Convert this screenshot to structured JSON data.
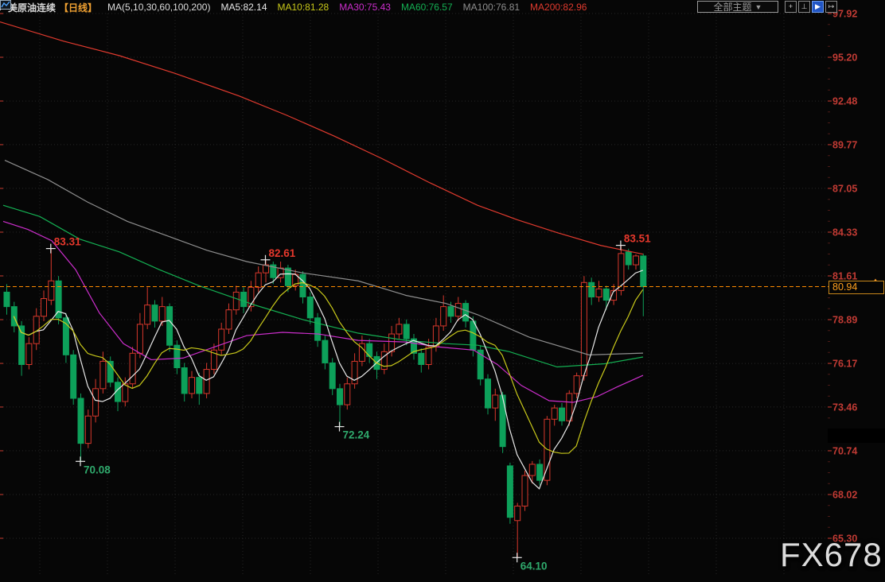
{
  "header": {
    "title": "美原油连续",
    "period": "【日线】",
    "ma_settings": "MA(5,10,30,60,100,200)",
    "ma_values": [
      {
        "label": "MA5:82.14",
        "color": "#e8e8e8"
      },
      {
        "label": "MA10:81.28",
        "color": "#c9c91a"
      },
      {
        "label": "MA30:75.43",
        "color": "#cc2ecc"
      },
      {
        "label": "MA60:76.57",
        "color": "#14b053"
      },
      {
        "label": "MA100:76.81",
        "color": "#8e8e8e"
      },
      {
        "label": "MA200:82.96",
        "color": "#e03a2e"
      }
    ],
    "theme_dropdown": "全部主题",
    "dropdown_arrow": "▼",
    "toolbar_icons": [
      {
        "name": "crosshair-icon",
        "glyph": "+",
        "active": false
      },
      {
        "name": "axis-scale-icon",
        "glyph": "⊥",
        "active": false
      },
      {
        "name": "axis-play-icon",
        "glyph": "▶",
        "active": true
      },
      {
        "name": "pan-right-icon",
        "glyph": "↦",
        "active": false
      }
    ]
  },
  "price_axis": {
    "labels": [
      "97.92",
      "95.20",
      "92.48",
      "89.77",
      "87.05",
      "84.33",
      "81.61",
      "78.89",
      "76.17",
      "73.46",
      "70.74",
      "68.02",
      "65.30"
    ],
    "label_color": "#c23b34",
    "current_price": "80.94",
    "current_price_value": 80.94,
    "line_color": "#ff8a00"
  },
  "watermark": "FX678",
  "chart_data": {
    "type": "candlestick",
    "title": "美原油连续 日线",
    "ylim": [
      65.3,
      97.92
    ],
    "grid": true,
    "legend_position": "top",
    "up_color": "#d8382c",
    "down_color": "#0da05a",
    "high_label_color": "#e6382c",
    "low_label_color": "#2fa96c",
    "last_price": 80.94,
    "candles": [
      [
        80.6,
        81.1,
        79.2,
        79.7
      ],
      [
        79.7,
        80.0,
        78.1,
        78.5
      ],
      [
        78.5,
        78.8,
        75.4,
        76.1
      ],
      [
        76.1,
        77.8,
        75.8,
        77.4
      ],
      [
        77.4,
        79.6,
        77.0,
        79.1
      ],
      [
        79.1,
        80.7,
        78.8,
        80.2
      ],
      [
        80.1,
        83.31,
        79.8,
        81.3
      ],
      [
        81.3,
        81.6,
        78.6,
        79.0
      ],
      [
        79.0,
        79.3,
        76.2,
        76.7
      ],
      [
        76.7,
        77.0,
        73.6,
        74.0
      ],
      [
        74.0,
        74.3,
        70.08,
        71.2
      ],
      [
        71.2,
        73.3,
        70.9,
        72.9
      ],
      [
        72.9,
        75.2,
        72.5,
        74.6
      ],
      [
        74.6,
        76.9,
        74.3,
        76.3
      ],
      [
        76.3,
        76.6,
        74.7,
        75.0
      ],
      [
        75.0,
        75.3,
        73.2,
        73.8
      ],
      [
        73.8,
        75.3,
        73.5,
        74.9
      ],
      [
        74.9,
        77.2,
        74.6,
        76.8
      ],
      [
        76.8,
        79.3,
        76.5,
        78.6
      ],
      [
        78.6,
        80.9,
        78.3,
        79.8
      ],
      [
        79.8,
        80.1,
        78.4,
        78.8
      ],
      [
        78.8,
        80.3,
        78.5,
        79.7
      ],
      [
        79.7,
        79.9,
        76.9,
        77.3
      ],
      [
        77.3,
        77.6,
        75.5,
        75.9
      ],
      [
        75.9,
        76.2,
        73.8,
        74.3
      ],
      [
        74.3,
        75.7,
        74.0,
        75.3
      ],
      [
        75.3,
        75.6,
        73.6,
        74.3
      ],
      [
        74.3,
        76.2,
        74.0,
        75.8
      ],
      [
        75.8,
        77.4,
        75.5,
        77.0
      ],
      [
        77.0,
        78.7,
        76.7,
        78.3
      ],
      [
        78.3,
        79.9,
        78.0,
        79.5
      ],
      [
        79.5,
        81.0,
        79.2,
        80.6
      ],
      [
        80.6,
        80.9,
        79.3,
        79.7
      ],
      [
        79.7,
        81.3,
        79.4,
        80.9
      ],
      [
        80.9,
        82.2,
        80.6,
        81.8
      ],
      [
        81.8,
        82.61,
        81.2,
        82.3
      ],
      [
        82.3,
        82.5,
        81.1,
        81.5
      ],
      [
        81.5,
        82.5,
        81.2,
        82.1
      ],
      [
        82.1,
        82.3,
        80.6,
        81.0
      ],
      [
        81.0,
        82.0,
        80.7,
        81.7
      ],
      [
        81.7,
        81.9,
        79.9,
        80.3
      ],
      [
        80.3,
        80.6,
        78.6,
        79.0
      ],
      [
        79.0,
        79.3,
        77.2,
        77.6
      ],
      [
        77.6,
        77.9,
        75.8,
        76.2
      ],
      [
        76.2,
        76.5,
        74.2,
        74.6
      ],
      [
        74.6,
        74.9,
        72.24,
        73.6
      ],
      [
        73.6,
        75.3,
        73.3,
        74.9
      ],
      [
        74.9,
        76.8,
        74.6,
        76.3
      ],
      [
        76.3,
        77.9,
        76.0,
        77.4
      ],
      [
        77.4,
        77.7,
        76.2,
        76.6
      ],
      [
        76.6,
        76.9,
        75.2,
        75.8
      ],
      [
        75.8,
        77.4,
        75.5,
        76.9
      ],
      [
        76.9,
        78.5,
        76.6,
        78.0
      ],
      [
        78.0,
        79.0,
        77.7,
        78.6
      ],
      [
        78.6,
        78.9,
        77.3,
        77.7
      ],
      [
        77.7,
        78.0,
        76.4,
        76.8
      ],
      [
        76.8,
        77.1,
        75.6,
        76.1
      ],
      [
        76.1,
        77.7,
        75.8,
        77.2
      ],
      [
        77.2,
        79.0,
        76.9,
        78.5
      ],
      [
        78.5,
        80.4,
        78.2,
        79.7
      ],
      [
        79.7,
        80.0,
        78.7,
        79.1
      ],
      [
        79.1,
        80.3,
        78.8,
        79.9
      ],
      [
        79.9,
        80.1,
        78.4,
        78.8
      ],
      [
        78.8,
        79.1,
        76.6,
        77.0
      ],
      [
        77.0,
        77.3,
        74.8,
        75.2
      ],
      [
        75.2,
        75.5,
        73.0,
        73.4
      ],
      [
        73.4,
        74.6,
        72.6,
        74.2
      ],
      [
        74.2,
        74.4,
        70.6,
        71.0
      ],
      [
        69.8,
        70.0,
        66.2,
        66.6
      ],
      [
        66.4,
        67.5,
        64.1,
        67.3
      ],
      [
        67.3,
        69.5,
        67.0,
        69.2
      ],
      [
        69.2,
        70.1,
        68.7,
        69.9
      ],
      [
        69.9,
        70.2,
        68.6,
        68.9
      ],
      [
        68.9,
        72.9,
        68.6,
        72.7
      ],
      [
        72.7,
        73.6,
        72.3,
        73.4
      ],
      [
        73.4,
        73.7,
        72.3,
        72.6
      ],
      [
        72.6,
        74.5,
        72.3,
        74.3
      ],
      [
        74.3,
        75.6,
        74.0,
        75.4
      ],
      [
        75.4,
        81.6,
        75.1,
        81.2
      ],
      [
        81.2,
        81.5,
        79.8,
        80.3
      ],
      [
        80.3,
        81.3,
        80.0,
        80.8
      ],
      [
        80.8,
        81.0,
        79.5,
        80.1
      ],
      [
        80.1,
        81.1,
        79.8,
        80.7
      ],
      [
        80.7,
        83.51,
        80.4,
        83.0
      ],
      [
        83.1,
        83.3,
        82.0,
        82.3
      ],
      [
        82.3,
        82.95,
        82.0,
        82.85
      ],
      [
        82.85,
        83.0,
        79.1,
        80.94
      ]
    ],
    "computed_ma": [
      {
        "name": "MA5",
        "window": 5,
        "color": "#e8e8e8"
      },
      {
        "name": "MA10",
        "window": 10,
        "color": "#c9c91a"
      }
    ],
    "ma_series": [
      {
        "name": "MA200",
        "color": "#e03a2e",
        "points": [
          [
            0,
            97.4
          ],
          [
            80,
            96.2
          ],
          [
            150,
            95.3
          ],
          [
            220,
            94.2
          ],
          [
            300,
            92.8
          ],
          [
            360,
            91.6
          ],
          [
            420,
            90.3
          ],
          [
            480,
            88.9
          ],
          [
            540,
            87.4
          ],
          [
            600,
            86.0
          ],
          [
            650,
            85.1
          ],
          [
            700,
            84.3
          ],
          [
            755,
            83.5
          ],
          [
            808,
            82.96
          ]
        ]
      },
      {
        "name": "MA100",
        "color": "#8e8e8e",
        "points": [
          [
            6,
            88.8
          ],
          [
            60,
            87.6
          ],
          [
            110,
            86.2
          ],
          [
            160,
            85.0
          ],
          [
            210,
            84.1
          ],
          [
            260,
            83.2
          ],
          [
            310,
            82.5
          ],
          [
            380,
            81.8
          ],
          [
            450,
            81.3
          ],
          [
            510,
            80.4
          ],
          [
            560,
            79.9
          ],
          [
            600,
            79.2
          ],
          [
            665,
            77.8
          ],
          [
            740,
            76.7
          ],
          [
            808,
            76.81
          ]
        ]
      },
      {
        "name": "MA60",
        "color": "#14b053",
        "points": [
          [
            4,
            86.0
          ],
          [
            50,
            85.3
          ],
          [
            100,
            83.9
          ],
          [
            150,
            83.1
          ],
          [
            200,
            82.0
          ],
          [
            250,
            81.0
          ],
          [
            320,
            79.8
          ],
          [
            380,
            78.9
          ],
          [
            450,
            78.05
          ],
          [
            510,
            77.6
          ],
          [
            560,
            77.4
          ],
          [
            600,
            77.3
          ],
          [
            640,
            76.9
          ],
          [
            700,
            75.95
          ],
          [
            760,
            76.15
          ],
          [
            808,
            76.57
          ]
        ]
      },
      {
        "name": "MA30",
        "color": "#cc2ecc",
        "points": [
          [
            4,
            85.0
          ],
          [
            35,
            84.5
          ],
          [
            65,
            83.8
          ],
          [
            95,
            82.0
          ],
          [
            125,
            79.3
          ],
          [
            155,
            77.4
          ],
          [
            190,
            76.4
          ],
          [
            230,
            76.5
          ],
          [
            270,
            77.2
          ],
          [
            310,
            77.9
          ],
          [
            355,
            78.1
          ],
          [
            400,
            78.0
          ],
          [
            450,
            77.6
          ],
          [
            510,
            77.5
          ],
          [
            550,
            77.2
          ],
          [
            595,
            77.0
          ],
          [
            625,
            76.1
          ],
          [
            655,
            74.8
          ],
          [
            690,
            73.85
          ],
          [
            720,
            73.75
          ],
          [
            750,
            74.1
          ],
          [
            775,
            74.7
          ],
          [
            808,
            75.43
          ]
        ]
      }
    ],
    "annotations": [
      {
        "text": "83.31",
        "index": 6,
        "price": 83.31,
        "side": "high"
      },
      {
        "text": "70.08",
        "index": 10,
        "price": 70.08,
        "side": "low"
      },
      {
        "text": "82.61",
        "index": 35,
        "price": 82.61,
        "side": "high"
      },
      {
        "text": "72.24",
        "index": 45,
        "price": 72.24,
        "side": "low"
      },
      {
        "text": "64.10",
        "index": 69,
        "price": 64.1,
        "side": "low"
      },
      {
        "text": "83.51",
        "index": 83,
        "price": 83.51,
        "side": "high"
      }
    ]
  }
}
